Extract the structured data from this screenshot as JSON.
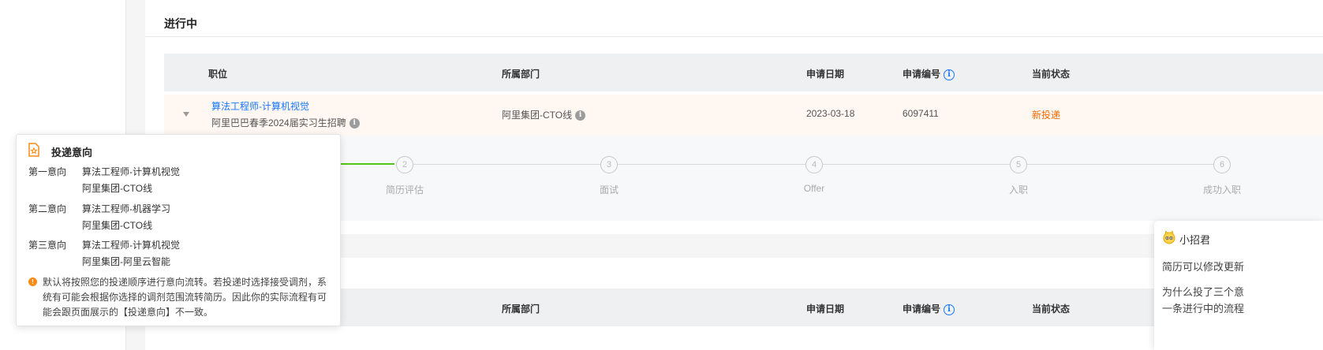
{
  "section": {
    "title": "进行中"
  },
  "table": {
    "headers": {
      "position": "职位",
      "department": "所属部门",
      "date": "申请日期",
      "app_no": "申请编号",
      "status": "当前状态"
    }
  },
  "application": {
    "job_title": "算法工程师-计算机视觉",
    "recruit_program": "阿里巴巴春季2024届实习生招聘",
    "department": "阿里集团-CTO线",
    "date": "2023-03-18",
    "app_no": "6097411",
    "status": "新投递"
  },
  "steps": [
    {
      "num": "2",
      "label": "简历评估"
    },
    {
      "num": "3",
      "label": "面试"
    },
    {
      "num": "4",
      "label": "Offer"
    },
    {
      "num": "5",
      "label": "入职"
    },
    {
      "num": "6",
      "label": "成功入职"
    }
  ],
  "popup": {
    "title": "投递意向",
    "preferences": [
      {
        "label": "第一意向",
        "job": "算法工程师-计算机视觉",
        "dept": "阿里集团-CTO线"
      },
      {
        "label": "第二意向",
        "job": "算法工程师-机器学习",
        "dept": "阿里集团-CTO线"
      },
      {
        "label": "第三意向",
        "job": "算法工程师-计算机视觉",
        "dept": "阿里集团-阿里云智能"
      }
    ],
    "notice": "默认将按照您的投递顺序进行意向流转。若投递时选择接受调剂，系统有可能会根据你选择的调剂范围流转简历。因此你的实际流程有可能会跟页面展示的【投递意向】不一致。"
  },
  "chat": {
    "name": "小招君",
    "line1": "简历可以修改更新",
    "line2": "为什么投了三个意",
    "line3": "一条进行中的流程"
  },
  "colors": {
    "link": "#1677ff",
    "status": "#ff6a00",
    "progress_done": "#52c41a",
    "warning": "#fa8c16"
  }
}
